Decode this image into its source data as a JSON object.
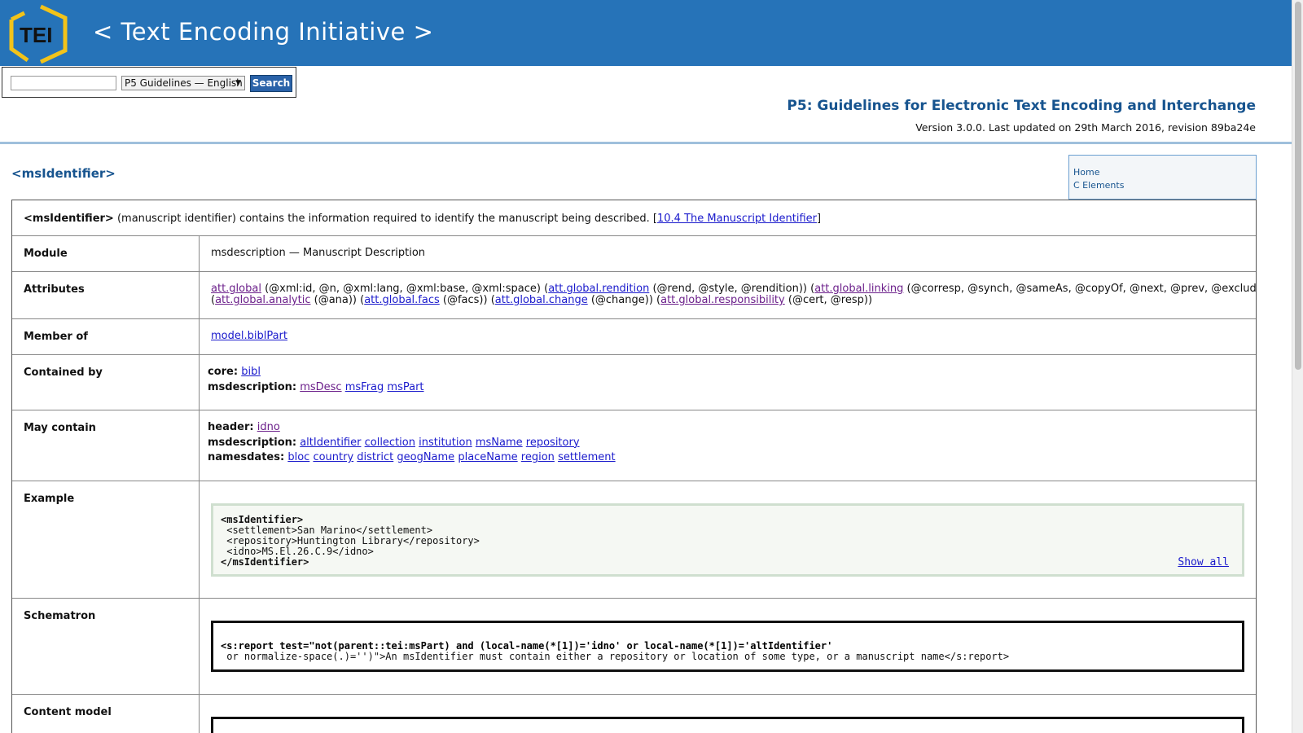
{
  "header": {
    "logo_text": "TEI",
    "title": "< Text Encoding Initiative >"
  },
  "search": {
    "input_value": "",
    "selected_option": "P5 Guidelines — English",
    "button_label": "Search"
  },
  "doc": {
    "guide_title": "P5: Guidelines for Electronic Text Encoding and Interchange",
    "version": "Version 3.0.0. Last updated on 29th March 2016, revision 89ba24e"
  },
  "element": {
    "name": "<msIdentifier>"
  },
  "sidenav": {
    "items": [
      "Home",
      "C Elements"
    ]
  },
  "description": {
    "name": "<msIdentifier>",
    "text": " (manuscript identifier) contains the information required to identify the manuscript being described. [",
    "link": "10.4 The Manuscript Identifier",
    "close": "]"
  },
  "rows": {
    "module": {
      "label": "Module",
      "value": "msdescription — Manuscript Description"
    },
    "attributes": {
      "label": "Attributes",
      "line1": [
        {
          "link": "att.global",
          "text": " (@xml:id, @n, @xml:lang, @xml:base, @xml:space) ("
        },
        {
          "link": "att.global.rendition",
          "text": " (@rend, @style, @rendition)) ("
        },
        {
          "link": "att.global.linking",
          "text": " (@corresp, @synch, @sameAs, @copyOf, @next, @prev, @exclude, @select))"
        }
      ],
      "line2": [
        {
          "pre": "(",
          "link": "att.global.analytic",
          "text": " (@ana)) ("
        },
        {
          "link": "att.global.facs",
          "text": " (@facs)) ("
        },
        {
          "link": "att.global.change",
          "text": " (@change)) ("
        },
        {
          "link": "att.global.responsibility",
          "text": " (@cert, @resp))"
        }
      ]
    },
    "member_of": {
      "label": "Member of",
      "link": "model.biblPart"
    },
    "contained_by": {
      "label": "Contained by",
      "groups": [
        {
          "module": "core:",
          "items": [
            "bibl"
          ]
        },
        {
          "module": "msdescription:",
          "items": [
            "msDesc",
            "msFrag",
            "msPart"
          ]
        }
      ]
    },
    "may_contain": {
      "label": "May contain",
      "groups": [
        {
          "module": "header:",
          "items": [
            "idno"
          ]
        },
        {
          "module": "msdescription:",
          "items": [
            "altIdentifier",
            "collection",
            "institution",
            "msName",
            "repository"
          ]
        },
        {
          "module": "namesdates:",
          "items": [
            "bloc",
            "country",
            "district",
            "geogName",
            "placeName",
            "region",
            "settlement"
          ]
        }
      ]
    },
    "example": {
      "label": "Example",
      "code_lines": [
        "<msIdentifier>",
        " <settlement>San Marino</settlement>",
        " <repository>Huntington Library</repository>",
        " <idno>MS.El.26.C.9</idno>",
        "</msIdentifier>"
      ],
      "show_all": "Show all"
    },
    "schematron": {
      "label": "Schematron",
      "line1": "<s:report test=\"not(parent::tei:msPart) and (local-name(*[1])='idno' or local-name(*[1])='altIdentifier'",
      "line2": " or normalize-space(.)='')\">An msIdentifier must contain either a repository or location of some type, or a manuscript name</s:report>"
    },
    "content_model": {
      "label": "Content model"
    }
  }
}
